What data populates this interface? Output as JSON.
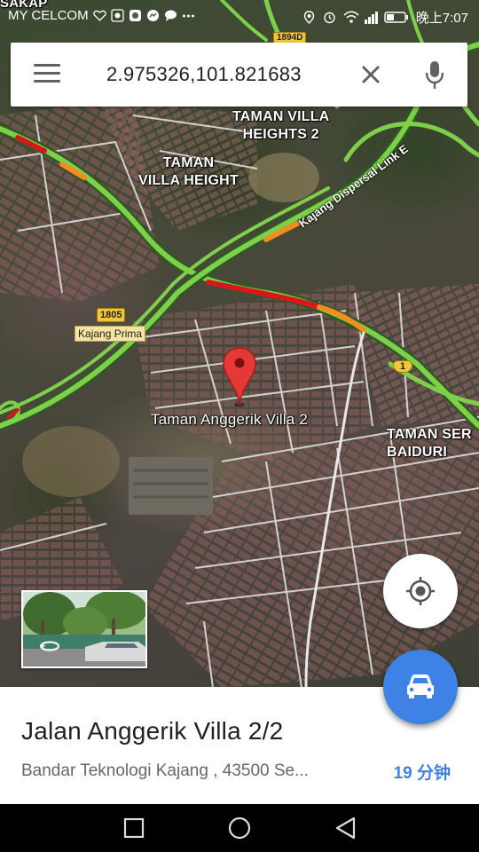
{
  "status_bar": {
    "carrier": "MY CELCOM",
    "time": "晚上7:07",
    "icons": [
      "heart-rate-icon",
      "browser-icon",
      "chat-icon",
      "messenger-icon",
      "message-icon",
      "more-dots-icon",
      "location-icon",
      "alarm-icon",
      "wifi-icon",
      "signal-icon",
      "battery-icon"
    ]
  },
  "search": {
    "query": "2.975326,101.821683",
    "menu_icon": "hamburger-menu-icon",
    "clear_icon": "close-icon",
    "mic_icon": "microphone-icon"
  },
  "map": {
    "labels": {
      "taman_sakap": "SAKAP",
      "taman_villa_heights_2": "TAMAN VILLA\nHEIGHTS 2",
      "taman_villa_height": "TAMAN\nVILLA HEIGHT",
      "taman_seri_baiduri": "TAMAN SER\nBAIDURI",
      "pin_label": "Taman Anggerik Villa 2"
    },
    "road_labels": {
      "kajang_dispersal": "Kajang Dispersal Link E",
      "route_1805": "1805",
      "route_1894": "1894D",
      "route_1": "1",
      "kajang_prima": "Kajang Prima"
    },
    "traffic_colors": {
      "free": "#7ed04b",
      "slow": "#f28c1f",
      "heavy": "#d8171d"
    }
  },
  "buttons": {
    "my_location_icon": "my-location-icon",
    "directions_icon": "car-icon"
  },
  "street_view": {
    "icon": "street-view-rotate-icon"
  },
  "place": {
    "title": "Jalan Anggerik Villa 2/2",
    "address": "Bandar Teknologi Kajang ,    43500 Se...",
    "travel_time": "19 分钟"
  },
  "nav_bar": {
    "icons": [
      "recent-apps-icon",
      "home-icon",
      "back-icon"
    ]
  }
}
